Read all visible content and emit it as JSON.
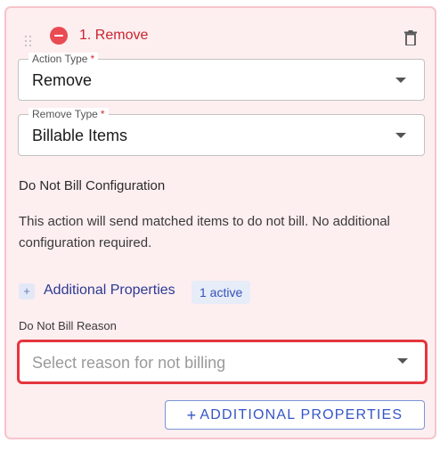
{
  "card": {
    "title": "1. Remove",
    "accent_color": "#ea4b52",
    "icons": [
      "drag-handle-icon",
      "remove-circle-icon",
      "trash-icon"
    ]
  },
  "action_type": {
    "label": "Action Type",
    "required_mark": "*",
    "value": "Remove"
  },
  "remove_type": {
    "label": "Remove Type",
    "required_mark": "*",
    "value": "Billable Items"
  },
  "do_not_bill": {
    "heading": "Do Not Bill Configuration",
    "info": "This action will send matched items to do not bill. No additional configuration required."
  },
  "additional_properties": {
    "expand_symbol": "+",
    "label": "Additional Properties",
    "badge": "1 active"
  },
  "reason": {
    "label": "Do Not Bill Reason",
    "placeholder": "Select reason for not billing",
    "highlight_color": "#e5353d"
  },
  "add_button": {
    "icon": "+",
    "label": "ADDITIONAL PROPERTIES"
  }
}
